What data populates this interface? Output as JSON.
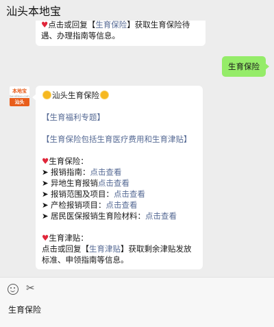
{
  "window": {
    "title": "汕头本地宝"
  },
  "previous_message": {
    "line1_prefix": "点击或回复【",
    "line1_link": "生育保险",
    "line1_suffix": "】获取生育保险待",
    "line2": "遇、办理指南等信息。"
  },
  "sent_message": {
    "text": "生育保险"
  },
  "avatar": {
    "logo_top": "本地宝",
    "logo_mid": "bendibao.com",
    "logo_bar": "汕头"
  },
  "main_message": {
    "title": "汕头生育保险",
    "topic_link": "【生育福利专题】",
    "coverage_link": "【生育保险包括生育医疗费用和生育津贴】",
    "section1_title": "生育保险：",
    "items": [
      {
        "label": "报销指南：",
        "link": "点击查看"
      },
      {
        "label": "异地生育报销",
        "link": "点击查看"
      },
      {
        "label": "报销范围及项目：",
        "link": "点击查看"
      },
      {
        "label": "产检报销项目：",
        "link": "点击查看"
      },
      {
        "label": "居民医保报销生育险材料：",
        "link": "点击查看"
      }
    ],
    "section2_title": "生育津贴：",
    "section2_line1_prefix": "点击或回复【",
    "section2_line1_link": "生育津贴",
    "section2_line1_suffix": "】获取剩余津贴发放",
    "section2_line2": "标准、申领指南等信息。"
  },
  "input_bar": {
    "text": "生育保险",
    "icons": [
      "emoji-icon",
      "scissors-icon"
    ]
  }
}
